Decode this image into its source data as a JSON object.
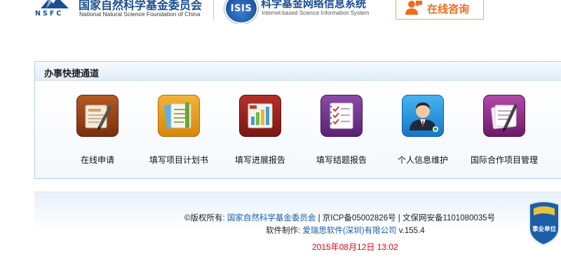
{
  "header": {
    "nsfc": {
      "logo_text": "NSFC",
      "name_cn": "国家自然科学基金委员会",
      "name_en": "National Natural Science Foundation of China"
    },
    "isis": {
      "logo_text": "ISIS",
      "name_cn": "科学基金网络信息系统",
      "name_en": "Internet-based Science Information System"
    },
    "consult_button": {
      "label": "在线咨询",
      "icon": "consult-person-icon"
    }
  },
  "quick_channel": {
    "title": "办事快捷通道",
    "items": [
      {
        "label": "在线申请",
        "icon": "online-apply-icon"
      },
      {
        "label": "填写项目计划书",
        "icon": "project-plan-icon"
      },
      {
        "label": "填写进展报告",
        "icon": "progress-report-icon"
      },
      {
        "label": "填写结题报告",
        "icon": "final-report-icon"
      },
      {
        "label": "个人信息维护",
        "icon": "user-profile-icon"
      },
      {
        "label": "国际合作项目管理",
        "icon": "international-cooperation-icon"
      }
    ]
  },
  "footer": {
    "copyright_prefix": "©版权所有:",
    "copyright_org": "国家自然科学基金委员会",
    "icp": "| 京ICP备05002826号 | 文保网安备1101080035号",
    "software_prefix": "软件制作:",
    "software_company": "爱瑞思软件(深圳)有限公司",
    "version": "v.155.4",
    "datetime": "2015年08月12日 13:02",
    "badge_text": "事业单位"
  },
  "colors": {
    "brand_blue": "#1b4f93",
    "consult_orange": "#f26b1d",
    "datetime_red": "#e60012",
    "panel_border": "#b4cde4"
  }
}
